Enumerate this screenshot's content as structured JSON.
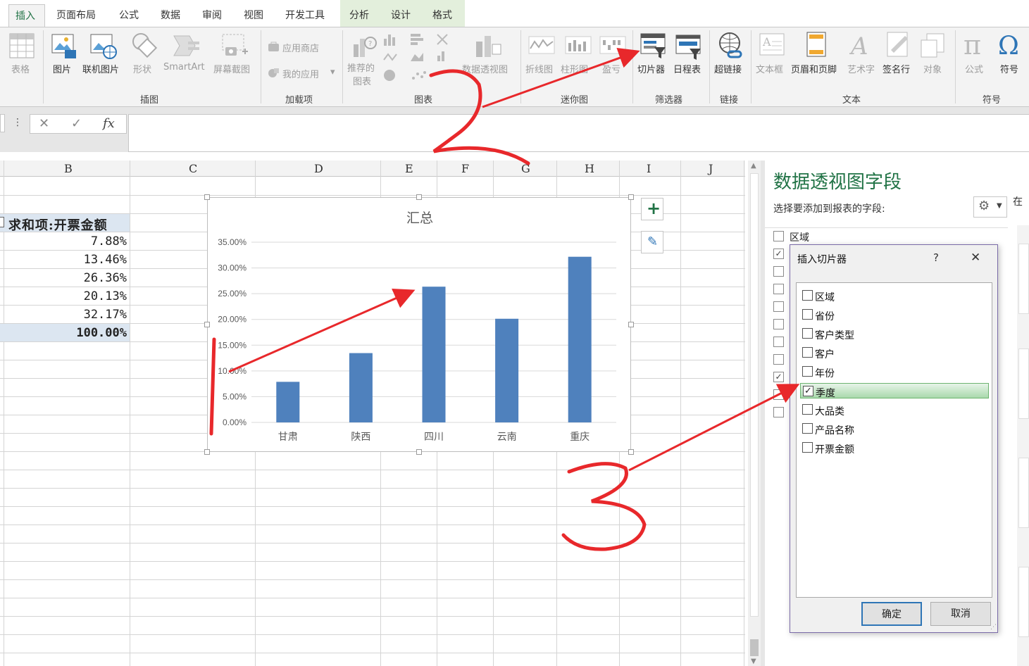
{
  "tabs": {
    "insert": "插入",
    "layout": "页面布局",
    "formula": "公式",
    "data": "数据",
    "review": "审阅",
    "view": "视图",
    "developer": "开发工具",
    "analyze": "分析",
    "design": "设计",
    "format": "格式"
  },
  "ribbon": {
    "table": "表格",
    "picture": "图片",
    "online_picture": "联机图片",
    "shapes": "形状",
    "smartart": "SmartArt",
    "screenshot": "屏幕截图",
    "store": "应用商店",
    "my_apps": "我的应用",
    "recommended_charts_1": "推荐的",
    "recommended_charts_2": "图表",
    "pivot_chart": "数据透视图",
    "spark_line": "折线图",
    "spark_column": "柱形图",
    "spark_winloss": "盈亏",
    "slicer": "切片器",
    "timeline": "日程表",
    "hyperlink": "超链接",
    "textbox": "文本框",
    "header_footer": "页眉和页脚",
    "wordart": "艺术字",
    "signature": "签名行",
    "object": "对象",
    "equation": "公式",
    "symbol": "符号",
    "groups": {
      "illustrations": "插图",
      "addins": "加载项",
      "charts": "图表",
      "sparklines": "迷你图",
      "filters": "筛选器",
      "links": "链接",
      "text": "文本",
      "symbols": "符号"
    }
  },
  "formula_bar": {
    "name_dots": "⋮",
    "cancel": "✕",
    "enter": "✓",
    "fx": "fx",
    "value": ""
  },
  "columns": [
    "B",
    "C",
    "D",
    "E",
    "F",
    "G",
    "H",
    "I",
    "J"
  ],
  "sheet": {
    "header": "求和项:开票金额",
    "values": [
      "7.88%",
      "13.46%",
      "26.36%",
      "20.13%",
      "32.17%"
    ],
    "total": "100.00%"
  },
  "chart_data": {
    "type": "bar",
    "title": "汇总",
    "categories": [
      "甘肃",
      "陕西",
      "四川",
      "云南",
      "重庆"
    ],
    "values": [
      7.88,
      13.46,
      26.36,
      20.13,
      32.17
    ],
    "yticks": [
      "0.00%",
      "5.00%",
      "10.00%",
      "15.00%",
      "20.00%",
      "25.00%",
      "30.00%",
      "35.00%"
    ],
    "ylim": [
      0,
      35
    ],
    "grid": true,
    "bar_color": "#4f81bd",
    "xlabel": "",
    "ylabel": ""
  },
  "chart_buttons": {
    "add": "+",
    "style": "✎"
  },
  "pivot_pane": {
    "title": "数据透视图字段",
    "subtitle": "选择要添加到报表的字段:",
    "first_field": "区域",
    "side_text": "在"
  },
  "dialog": {
    "title": "插入切片器",
    "help": "?",
    "close": "✕",
    "items": [
      "区域",
      "省份",
      "客户类型",
      "客户",
      "年份",
      "季度",
      "大品类",
      "产品名称",
      "开票金额"
    ],
    "checked_index": 5,
    "ok": "确定",
    "cancel": "取消"
  },
  "annotations": [
    "1",
    "2",
    "3"
  ],
  "colors": {
    "excel_green": "#217346",
    "annotation_red": "#e8282b",
    "selected_row": "#c6e6c8"
  }
}
